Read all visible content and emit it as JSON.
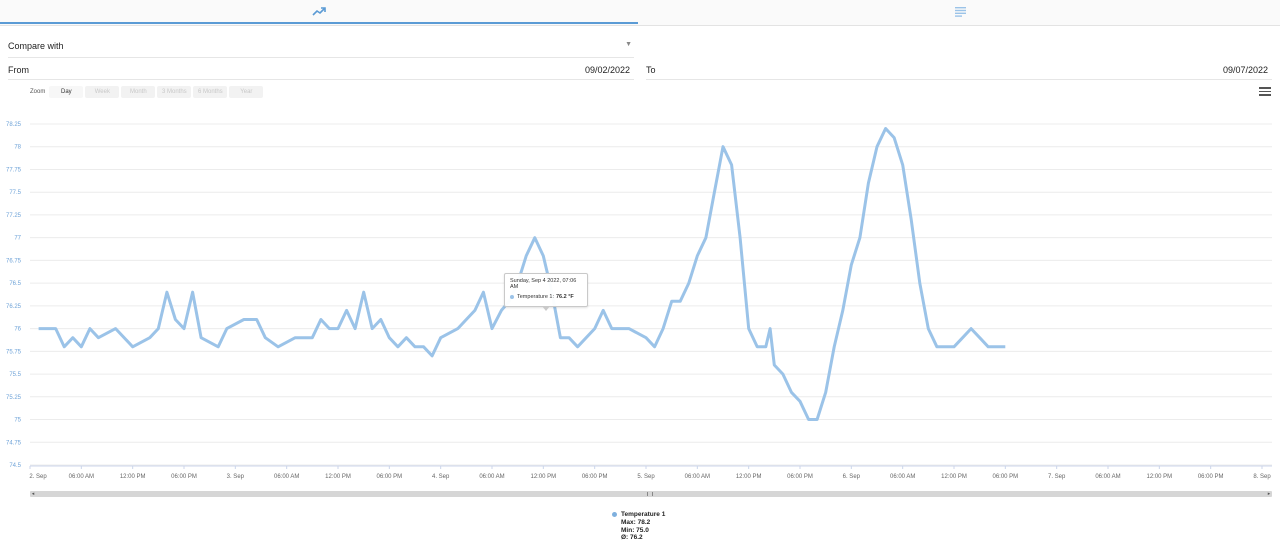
{
  "tabs": [
    {
      "icon": "trend-chart-icon",
      "active": true
    },
    {
      "icon": "list-icon",
      "active": false
    }
  ],
  "compare": {
    "label": "Compare with"
  },
  "range": {
    "from_label": "From",
    "from_value": "09/02/2022",
    "to_label": "To",
    "to_value": "09/07/2022"
  },
  "zoom": {
    "label": "Zoom",
    "buttons": [
      "Day",
      "Week",
      "Month",
      "3 Months",
      "6 Months",
      "Year"
    ],
    "active": "Day"
  },
  "colors": {
    "series": "#9bc3e8",
    "axis_label": "#6fa3d8",
    "accent": "#5b9bd5"
  },
  "chart_data": {
    "type": "line",
    "ylim": [
      74.5,
      78.25
    ],
    "y_ticks": [
      "78.25",
      "78",
      "77.75",
      "77.5",
      "77.25",
      "77",
      "76.75",
      "76.5",
      "76.25",
      "76",
      "75.75",
      "75.5",
      "75.25",
      "75",
      "74.75",
      "74.5"
    ],
    "x_tick_labels": [
      "2. Sep",
      "06:00 AM",
      "12:00 PM",
      "06:00 PM",
      "3. Sep",
      "06:00 AM",
      "12:00 PM",
      "06:00 PM",
      "4. Sep",
      "06:00 AM",
      "12:00 PM",
      "06:00 PM",
      "5. Sep",
      "06:00 AM",
      "12:00 PM",
      "06:00 PM",
      "6. Sep",
      "06:00 AM",
      "12:00 PM",
      "06:00 PM",
      "7. Sep",
      "06:00 AM",
      "12:00 PM",
      "06:00 PM",
      "8. Sep"
    ],
    "x_range": [
      "2022-09-02 00:00",
      "2022-09-08 00:00"
    ],
    "grid": true,
    "legend_position": "bottom-center",
    "series": [
      {
        "name": "Temperature 1",
        "unit": "°F",
        "points": [
          [
            "2022-09-02 01:00",
            76.0
          ],
          [
            "2022-09-02 03:00",
            76.0
          ],
          [
            "2022-09-02 04:00",
            75.8
          ],
          [
            "2022-09-02 05:00",
            75.9
          ],
          [
            "2022-09-02 06:00",
            75.8
          ],
          [
            "2022-09-02 07:00",
            76.0
          ],
          [
            "2022-09-02 08:00",
            75.9
          ],
          [
            "2022-09-02 10:00",
            76.0
          ],
          [
            "2022-09-02 12:00",
            75.8
          ],
          [
            "2022-09-02 14:00",
            75.9
          ],
          [
            "2022-09-02 15:00",
            76.0
          ],
          [
            "2022-09-02 16:00",
            76.4
          ],
          [
            "2022-09-02 17:00",
            76.1
          ],
          [
            "2022-09-02 18:00",
            76.0
          ],
          [
            "2022-09-02 19:00",
            76.4
          ],
          [
            "2022-09-02 20:00",
            75.9
          ],
          [
            "2022-09-02 22:00",
            75.8
          ],
          [
            "2022-09-02 23:00",
            76.0
          ],
          [
            "2022-09-03 01:00",
            76.1
          ],
          [
            "2022-09-03 02:30",
            76.1
          ],
          [
            "2022-09-03 03:30",
            75.9
          ],
          [
            "2022-09-03 05:00",
            75.8
          ],
          [
            "2022-09-03 07:00",
            75.9
          ],
          [
            "2022-09-03 09:00",
            75.9
          ],
          [
            "2022-09-03 10:00",
            76.1
          ],
          [
            "2022-09-03 11:00",
            76.0
          ],
          [
            "2022-09-03 12:00",
            76.0
          ],
          [
            "2022-09-03 13:00",
            76.2
          ],
          [
            "2022-09-03 14:00",
            76.0
          ],
          [
            "2022-09-03 15:00",
            76.4
          ],
          [
            "2022-09-03 16:00",
            76.0
          ],
          [
            "2022-09-03 17:00",
            76.1
          ],
          [
            "2022-09-03 18:00",
            75.9
          ],
          [
            "2022-09-03 19:00",
            75.8
          ],
          [
            "2022-09-03 20:00",
            75.9
          ],
          [
            "2022-09-03 21:00",
            75.8
          ],
          [
            "2022-09-03 22:00",
            75.8
          ],
          [
            "2022-09-03 23:00",
            75.7
          ],
          [
            "2022-09-04 00:00",
            75.9
          ],
          [
            "2022-09-04 02:00",
            76.0
          ],
          [
            "2022-09-04 03:00",
            76.1
          ],
          [
            "2022-09-04 04:00",
            76.2
          ],
          [
            "2022-09-04 05:00",
            76.4
          ],
          [
            "2022-09-04 06:00",
            76.0
          ],
          [
            "2022-09-04 07:06",
            76.2
          ],
          [
            "2022-09-04 08:00",
            76.3
          ],
          [
            "2022-09-04 09:00",
            76.5
          ],
          [
            "2022-09-04 10:00",
            76.8
          ],
          [
            "2022-09-04 11:00",
            77.0
          ],
          [
            "2022-09-04 12:00",
            76.8
          ],
          [
            "2022-09-04 13:00",
            76.4
          ],
          [
            "2022-09-04 14:00",
            75.9
          ],
          [
            "2022-09-04 15:00",
            75.9
          ],
          [
            "2022-09-04 16:00",
            75.8
          ],
          [
            "2022-09-04 18:00",
            76.0
          ],
          [
            "2022-09-04 19:00",
            76.2
          ],
          [
            "2022-09-04 20:00",
            76.0
          ],
          [
            "2022-09-04 22:00",
            76.0
          ],
          [
            "2022-09-05 00:00",
            75.9
          ],
          [
            "2022-09-05 01:00",
            75.8
          ],
          [
            "2022-09-05 02:00",
            76.0
          ],
          [
            "2022-09-05 03:00",
            76.3
          ],
          [
            "2022-09-05 04:00",
            76.3
          ],
          [
            "2022-09-05 05:00",
            76.5
          ],
          [
            "2022-09-05 06:00",
            76.8
          ],
          [
            "2022-09-05 07:00",
            77.0
          ],
          [
            "2022-09-05 08:00",
            77.5
          ],
          [
            "2022-09-05 09:00",
            78.0
          ],
          [
            "2022-09-05 10:00",
            77.8
          ],
          [
            "2022-09-05 11:00",
            77.0
          ],
          [
            "2022-09-05 12:00",
            76.0
          ],
          [
            "2022-09-05 13:00",
            75.8
          ],
          [
            "2022-09-05 14:00",
            75.8
          ],
          [
            "2022-09-05 14:30",
            76.0
          ],
          [
            "2022-09-05 15:00",
            75.6
          ],
          [
            "2022-09-05 16:00",
            75.5
          ],
          [
            "2022-09-05 17:00",
            75.3
          ],
          [
            "2022-09-05 18:00",
            75.2
          ],
          [
            "2022-09-05 19:00",
            75.0
          ],
          [
            "2022-09-05 20:00",
            75.0
          ],
          [
            "2022-09-05 21:00",
            75.3
          ],
          [
            "2022-09-05 22:00",
            75.8
          ],
          [
            "2022-09-05 23:00",
            76.2
          ],
          [
            "2022-09-06 00:00",
            76.7
          ],
          [
            "2022-09-06 01:00",
            77.0
          ],
          [
            "2022-09-06 02:00",
            77.6
          ],
          [
            "2022-09-06 03:00",
            78.0
          ],
          [
            "2022-09-06 04:00",
            78.2
          ],
          [
            "2022-09-06 05:00",
            78.1
          ],
          [
            "2022-09-06 06:00",
            77.8
          ],
          [
            "2022-09-06 07:00",
            77.2
          ],
          [
            "2022-09-06 08:00",
            76.5
          ],
          [
            "2022-09-06 09:00",
            76.0
          ],
          [
            "2022-09-06 10:00",
            75.8
          ],
          [
            "2022-09-06 12:00",
            75.8
          ],
          [
            "2022-09-06 13:00",
            75.9
          ],
          [
            "2022-09-06 14:00",
            76.0
          ],
          [
            "2022-09-06 15:00",
            75.9
          ],
          [
            "2022-09-06 16:00",
            75.8
          ],
          [
            "2022-09-06 18:00",
            75.8
          ]
        ]
      }
    ],
    "tooltip": {
      "date": "Sunday, Sep 4 2022, 07:06 AM",
      "series": "Temperature 1",
      "value": "76.2 °F"
    },
    "legend": {
      "name": "Temperature 1",
      "max": "Max: 78.2",
      "min": "Min: 75.0",
      "avg": "Ø: 76.2"
    }
  }
}
